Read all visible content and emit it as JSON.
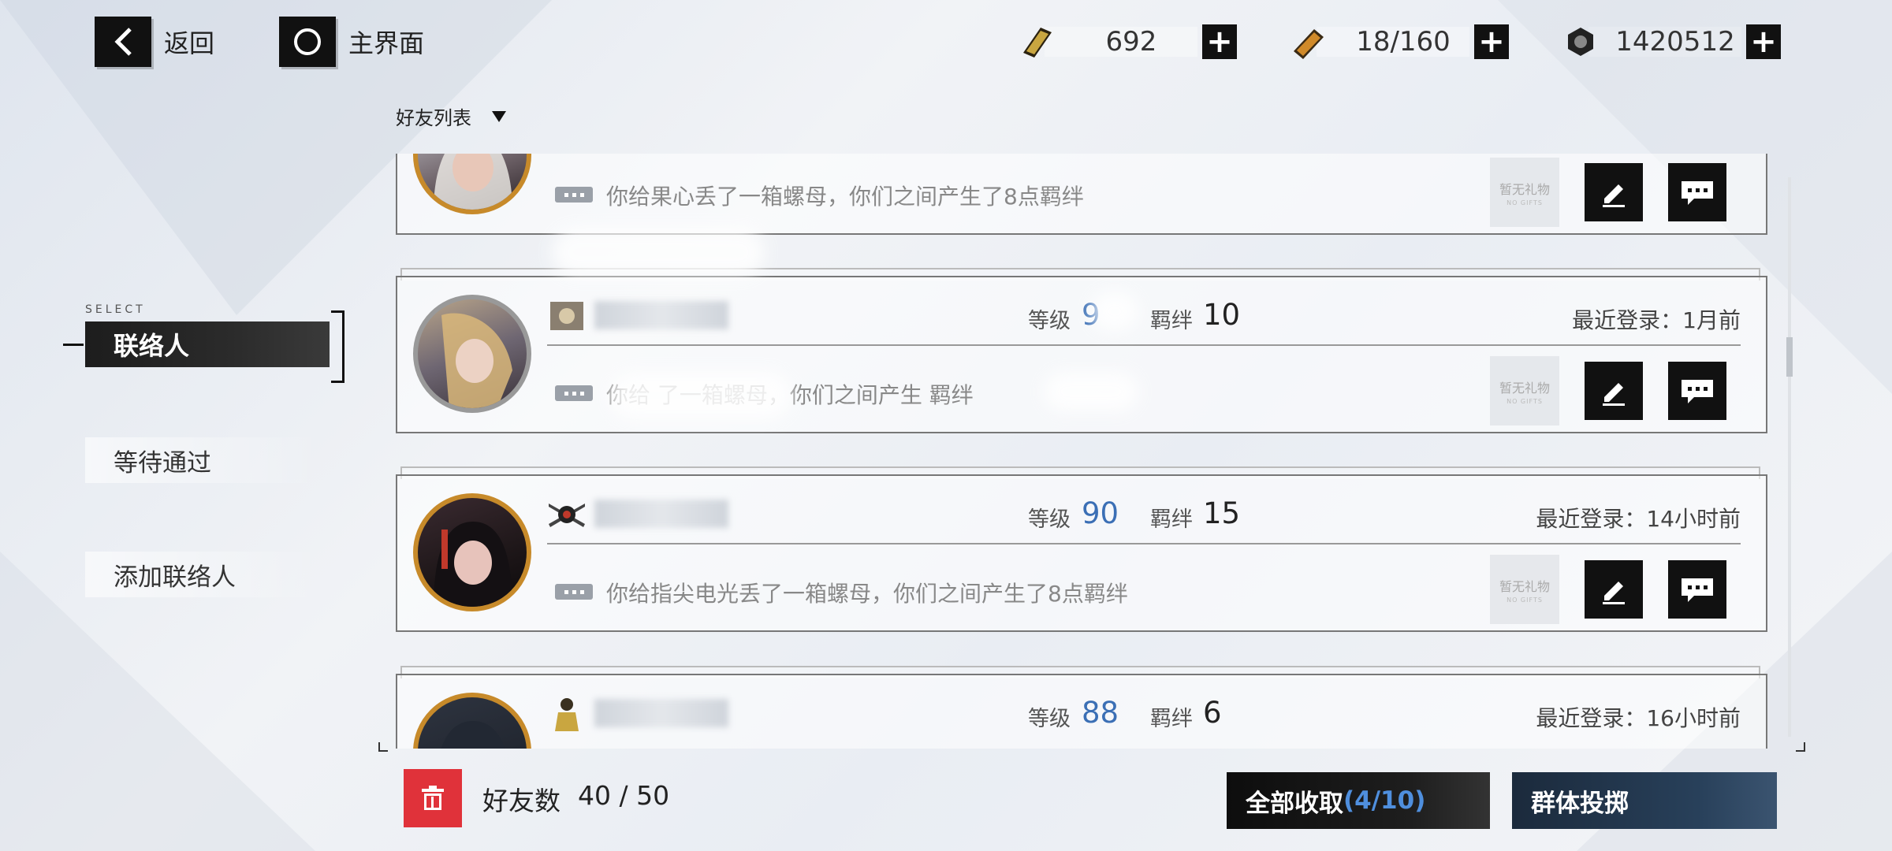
{
  "top_bar": {
    "back_label": "返回",
    "home_label": "主界面",
    "resources": [
      {
        "icon": "ticket-icon",
        "value": "692"
      },
      {
        "icon": "battery-icon",
        "value": "18/160"
      },
      {
        "icon": "nut-icon",
        "value": "1420512"
      }
    ]
  },
  "dropdown": {
    "label": "好友列表"
  },
  "nav": {
    "select_tag": "SELECT",
    "items": [
      "联络人",
      "等待通过",
      "添加联络人"
    ],
    "active": "联络人"
  },
  "friends": [
    {
      "level_label": "",
      "level": "",
      "bond_label": "",
      "bond": "",
      "last_login": "",
      "message": "你给果心丢了一箱螺母，你们之间产生了8点羁绊",
      "gift": "暂无礼物",
      "gift_sub": "NO GIFTS",
      "avatar_border": "#c78a2a"
    },
    {
      "level_label": "等级",
      "level": "9",
      "bond_label": "羁绊",
      "bond": "10",
      "last_login": "最近登录：1月前",
      "message": "你给              了一箱螺母，你们之间产生      羁绊",
      "gift": "暂无礼物",
      "gift_sub": "NO GIFTS",
      "avatar_border": "#999999"
    },
    {
      "level_label": "等级",
      "level": "90",
      "bond_label": "羁绊",
      "bond": "15",
      "last_login": "最近登录：14小时前",
      "message": "你给指尖电光丢了一箱螺母，你们之间产生了8点羁绊",
      "gift": "暂无礼物",
      "gift_sub": "NO GIFTS",
      "avatar_border": "#c78a2a"
    },
    {
      "level_label": "等级",
      "level": "88",
      "bond_label": "羁绊",
      "bond": "6",
      "last_login": "最近登录：16小时前",
      "message": "",
      "gift": "",
      "gift_sub": "",
      "avatar_border": "#c78a2a"
    }
  ],
  "bottom": {
    "friend_count_label": "好友数",
    "friend_count": "40 / 50",
    "collect_label": "全部收取",
    "collect_count": "(4/10)",
    "group_label": "群体投掷"
  },
  "colors": {
    "accent_blue": "#3b6fb5",
    "trash_red": "#e0323a",
    "avatar_gold": "#c78a2a"
  }
}
